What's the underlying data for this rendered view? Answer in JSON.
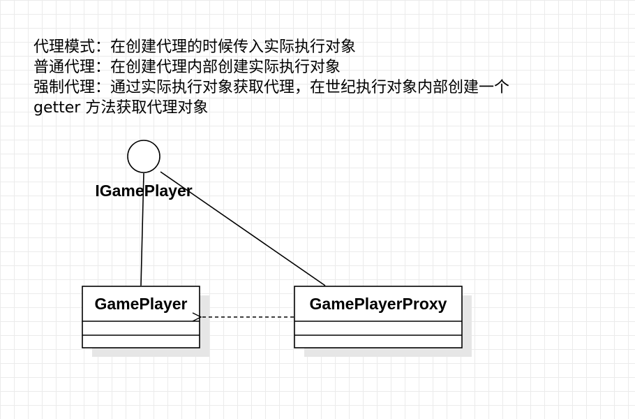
{
  "notes": {
    "lines": [
      "代理模式：在创建代理的时候传入实际执行对象",
      "普通代理：在创建代理内部创建实际执行对象",
      "强制代理：通过实际执行对象获取代理，在世纪执行对象内部创建一个",
      "getter 方法获取代理对象"
    ]
  },
  "interface": {
    "name": "IGamePlayer"
  },
  "classes": [
    {
      "name": "GamePlayer"
    },
    {
      "name": "GamePlayerProxy"
    }
  ]
}
